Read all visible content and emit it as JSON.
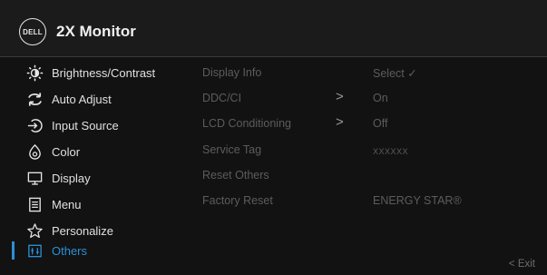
{
  "header": {
    "logo_text": "DELL",
    "title": "2X Monitor"
  },
  "menu": {
    "items": [
      {
        "label": "Brightness/Contrast",
        "icon": "brightness-icon"
      },
      {
        "label": "Auto Adjust",
        "icon": "auto-adjust-icon"
      },
      {
        "label": "Input Source",
        "icon": "input-source-icon"
      },
      {
        "label": "Color",
        "icon": "color-icon"
      },
      {
        "label": "Display",
        "icon": "display-icon"
      },
      {
        "label": "Menu",
        "icon": "menu-icon"
      },
      {
        "label": "Personalize",
        "icon": "star-icon"
      },
      {
        "label": "Others",
        "icon": "others-icon"
      }
    ],
    "active": "Others"
  },
  "submenu": {
    "items": [
      {
        "label": "Display Info",
        "arrow": "",
        "value": "Select ✓"
      },
      {
        "label": "DDC/CI",
        "arrow": ">",
        "value": "On"
      },
      {
        "label": "LCD Conditioning",
        "arrow": ">",
        "value": "Off"
      },
      {
        "label": "Service Tag",
        "arrow": "",
        "value": "XXXXXX"
      },
      {
        "label": "Reset Others",
        "arrow": "",
        "value": ""
      },
      {
        "label": "Factory Reset",
        "arrow": "",
        "value": "ENERGY STAR®"
      }
    ]
  },
  "footer": {
    "exit": "< Exit"
  },
  "colors": {
    "accent": "#2b8fd6",
    "disabled_text": "#5c5c5c",
    "background": "#121212"
  }
}
